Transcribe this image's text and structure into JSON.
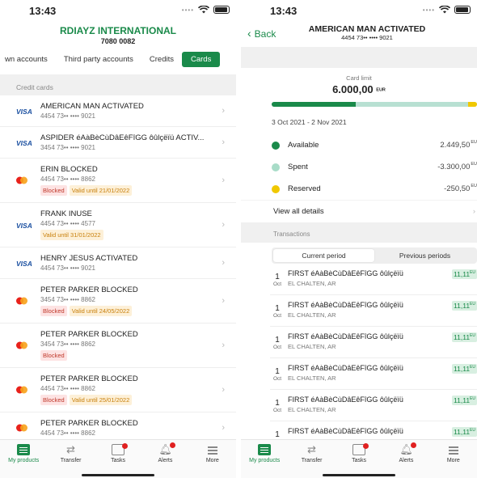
{
  "left": {
    "status_time": "13:43",
    "company": "RDIAYZ INTERNATIONAL",
    "company_number": "7080 0082",
    "tabs": [
      "wn accounts",
      "Third party accounts",
      "Credits",
      "Cards"
    ],
    "section_label": "Credit cards",
    "cards": [
      {
        "brand": "visa",
        "brand_label": "VISA",
        "name": "AMERICAN MAN ACTIVATED",
        "mask": "4454 73•• •••• 9021",
        "blocked": "",
        "valid": ""
      },
      {
        "brand": "visa",
        "brand_label": "VISA",
        "name": "ASPIDER éAàBèCùDâEêFîGG ôûlçëïü ACTIV...",
        "mask": "3454 73•• •••• 9021",
        "blocked": "",
        "valid": ""
      },
      {
        "brand": "mastercard",
        "brand_label": "",
        "name": "ERIN BLOCKED",
        "mask": "4454 73•• •••• 8862",
        "blocked": "Blocked",
        "valid": "Valid until 21/01/2022"
      },
      {
        "brand": "visa",
        "brand_label": "VISA",
        "name": "FRANK INUSE",
        "mask": "4454 73•• •••• 4577",
        "blocked": "",
        "valid": "Valid until 31/01/2022"
      },
      {
        "brand": "visa",
        "brand_label": "VISA",
        "name": "HENRY JESUS ACTIVATED",
        "mask": "4454 73•• •••• 9021",
        "blocked": "",
        "valid": ""
      },
      {
        "brand": "mastercard",
        "brand_label": "",
        "name": "PETER PARKER BLOCKED",
        "mask": "3454 73•• •••• 8862",
        "blocked": "Blocked",
        "valid": "Valid until 24/05/2022"
      },
      {
        "brand": "mastercard",
        "brand_label": "",
        "name": "PETER PARKER BLOCKED",
        "mask": "3454 73•• •••• 8862",
        "blocked": "Blocked",
        "valid": ""
      },
      {
        "brand": "mastercard",
        "brand_label": "",
        "name": "PETER PARKER BLOCKED",
        "mask": "4454 73•• •••• 8862",
        "blocked": "Blocked",
        "valid": "Valid until 25/01/2022"
      },
      {
        "brand": "mastercard",
        "brand_label": "",
        "name": "PETER PARKER BLOCKED",
        "mask": "4454 73•• •••• 8862",
        "blocked": "",
        "valid": ""
      }
    ]
  },
  "nav": [
    {
      "label": "My products",
      "icon": "products-icon",
      "badge": false,
      "active": true
    },
    {
      "label": "Transfer",
      "icon": "transfer-icon",
      "badge": false,
      "active": false
    },
    {
      "label": "Tasks",
      "icon": "tasks-icon",
      "badge": true,
      "active": false
    },
    {
      "label": "Alerts",
      "icon": "bell-icon",
      "badge": true,
      "active": false
    },
    {
      "label": "More",
      "icon": "menu-icon",
      "badge": false,
      "active": false
    }
  ],
  "right": {
    "status_time": "13:43",
    "back_label": "Back",
    "title": "AMERICAN MAN ACTIVATED",
    "card_number": "4454 73•• •••• 9021",
    "limit_label": "Card limit",
    "limit_amount": "6.000,00",
    "limit_currency": "EUR",
    "usage": {
      "available_fraction": 0.408,
      "reserved_fraction": 0.042
    },
    "period": "3 Oct 2021 - 2 Nov 2021",
    "legend": [
      {
        "label": "Available",
        "value": "2.449,50",
        "currency": "EU",
        "color": "#1a8a4a"
      },
      {
        "label": "Spent",
        "value": "-3.300,00",
        "currency": "EU",
        "color": "#a8dcc8"
      },
      {
        "label": "Reserved",
        "value": "-250,50",
        "currency": "EU",
        "color": "#f0c800"
      }
    ],
    "view_all": "View all details",
    "transactions_label": "Transactions",
    "segments": [
      "Current period",
      "Previous periods"
    ],
    "transactions": [
      {
        "day": "1",
        "month": "Oct",
        "desc": "FIRST éAàBèCùDâEêFîGG ôûlçëïü",
        "loc": "EL CHALTEN, AR",
        "amount": "11,11",
        "currency": "EU"
      },
      {
        "day": "1",
        "month": "Oct",
        "desc": "FIRST éAàBèCùDâEêFîGG ôûlçëïü",
        "loc": "EL CHALTEN, AR",
        "amount": "11,11",
        "currency": "EU"
      },
      {
        "day": "1",
        "month": "Oct",
        "desc": "FIRST éAàBèCùDâEêFîGG ôûlçëïü",
        "loc": "EL CHALTEN, AR",
        "amount": "11,11",
        "currency": "EU"
      },
      {
        "day": "1",
        "month": "Oct",
        "desc": "FIRST éAàBèCùDâEêFîGG ôûlçëïü",
        "loc": "EL CHALTEN, AR",
        "amount": "11,11",
        "currency": "EU"
      },
      {
        "day": "1",
        "month": "Oct",
        "desc": "FIRST éAàBèCùDâEêFîGG ôûlçëïü",
        "loc": "EL CHALTEN, AR",
        "amount": "11,11",
        "currency": "EU"
      },
      {
        "day": "1",
        "month": "Oct",
        "desc": "FIRST éAàBèCùDâEêFîGG ôûlçëïü",
        "loc": "EL CHALTEN, AR",
        "amount": "11,11",
        "currency": "EU"
      }
    ]
  }
}
